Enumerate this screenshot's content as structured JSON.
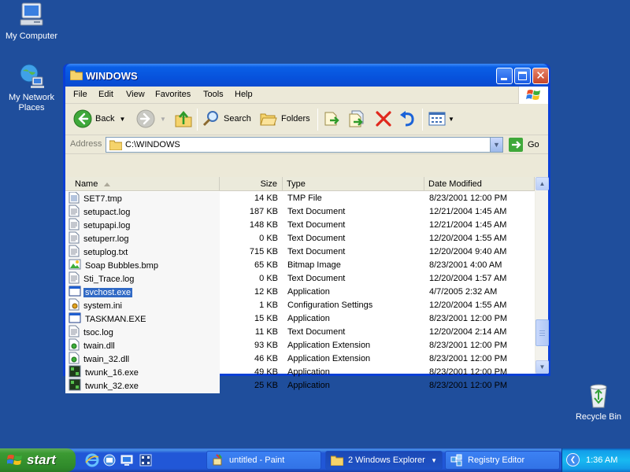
{
  "desktop": {
    "icons": [
      {
        "label_line1": "My Computer",
        "label_line2": ""
      },
      {
        "label_line1": "My Network",
        "label_line2": "Places"
      },
      {
        "label_line1": "Recycle Bin",
        "label_line2": ""
      }
    ]
  },
  "window": {
    "title": "WINDOWS",
    "menu": [
      "File",
      "Edit",
      "View",
      "Favorites",
      "Tools",
      "Help"
    ],
    "toolbar": {
      "back_label": "Back",
      "search_label": "Search",
      "folders_label": "Folders"
    },
    "address": {
      "label": "Address",
      "value": "C:\\WINDOWS",
      "go_label": "Go"
    },
    "columns": {
      "name": "Name",
      "size": "Size",
      "type": "Type",
      "date": "Date Modified"
    },
    "files": [
      {
        "name": "SET7.tmp",
        "size": "14 KB",
        "type": "TMP File",
        "date": "8/23/2001 12:00 PM",
        "icon": "tmp-file-icon"
      },
      {
        "name": "setupact.log",
        "size": "187 KB",
        "type": "Text Document",
        "date": "12/21/2004 1:45 AM",
        "icon": "text-file-icon"
      },
      {
        "name": "setupapi.log",
        "size": "148 KB",
        "type": "Text Document",
        "date": "12/21/2004 1:45 AM",
        "icon": "text-file-icon"
      },
      {
        "name": "setuperr.log",
        "size": "0 KB",
        "type": "Text Document",
        "date": "12/20/2004 1:55 AM",
        "icon": "text-file-icon"
      },
      {
        "name": "setuplog.txt",
        "size": "715 KB",
        "type": "Text Document",
        "date": "12/20/2004 9:40 AM",
        "icon": "text-file-icon"
      },
      {
        "name": "Soap Bubbles.bmp",
        "size": "65 KB",
        "type": "Bitmap Image",
        "date": "8/23/2001 4:00 AM",
        "icon": "bitmap-icon"
      },
      {
        "name": "Sti_Trace.log",
        "size": "0 KB",
        "type": "Text Document",
        "date": "12/20/2004 1:57 AM",
        "icon": "text-file-icon"
      },
      {
        "name": "svchost.exe",
        "size": "12 KB",
        "type": "Application",
        "date": "4/7/2005 2:32 AM",
        "icon": "application-icon",
        "selected": true
      },
      {
        "name": "system.ini",
        "size": "1 KB",
        "type": "Configuration Settings",
        "date": "12/20/2004 1:55 AM",
        "icon": "config-file-icon"
      },
      {
        "name": "TASKMAN.EXE",
        "size": "15 KB",
        "type": "Application",
        "date": "8/23/2001 12:00 PM",
        "icon": "application-icon"
      },
      {
        "name": "tsoc.log",
        "size": "11 KB",
        "type": "Text Document",
        "date": "12/20/2004 2:14 AM",
        "icon": "text-file-icon"
      },
      {
        "name": "twain.dll",
        "size": "93 KB",
        "type": "Application Extension",
        "date": "8/23/2001 12:00 PM",
        "icon": "dll-icon"
      },
      {
        "name": "twain_32.dll",
        "size": "46 KB",
        "type": "Application Extension",
        "date": "8/23/2001 12:00 PM",
        "icon": "dll-icon"
      },
      {
        "name": "twunk_16.exe",
        "size": "49 KB",
        "type": "Application",
        "date": "8/23/2001 12:00 PM",
        "icon": "twain-app-icon"
      },
      {
        "name": "twunk_32.exe",
        "size": "25 KB",
        "type": "Application",
        "date": "8/23/2001 12:00 PM",
        "icon": "twain-app-icon"
      }
    ]
  },
  "taskbar": {
    "start_label": "start",
    "tasks": [
      {
        "label": "untitled - Paint"
      },
      {
        "label": "2 Windows Explorer"
      },
      {
        "label": "Registry Editor"
      }
    ],
    "clock": "1:36 AM"
  },
  "colors": {
    "desktop": "#1f4e9c",
    "selection": "#316ac5",
    "titlebar": "#0752dc",
    "start_green": "#3c9a33"
  }
}
